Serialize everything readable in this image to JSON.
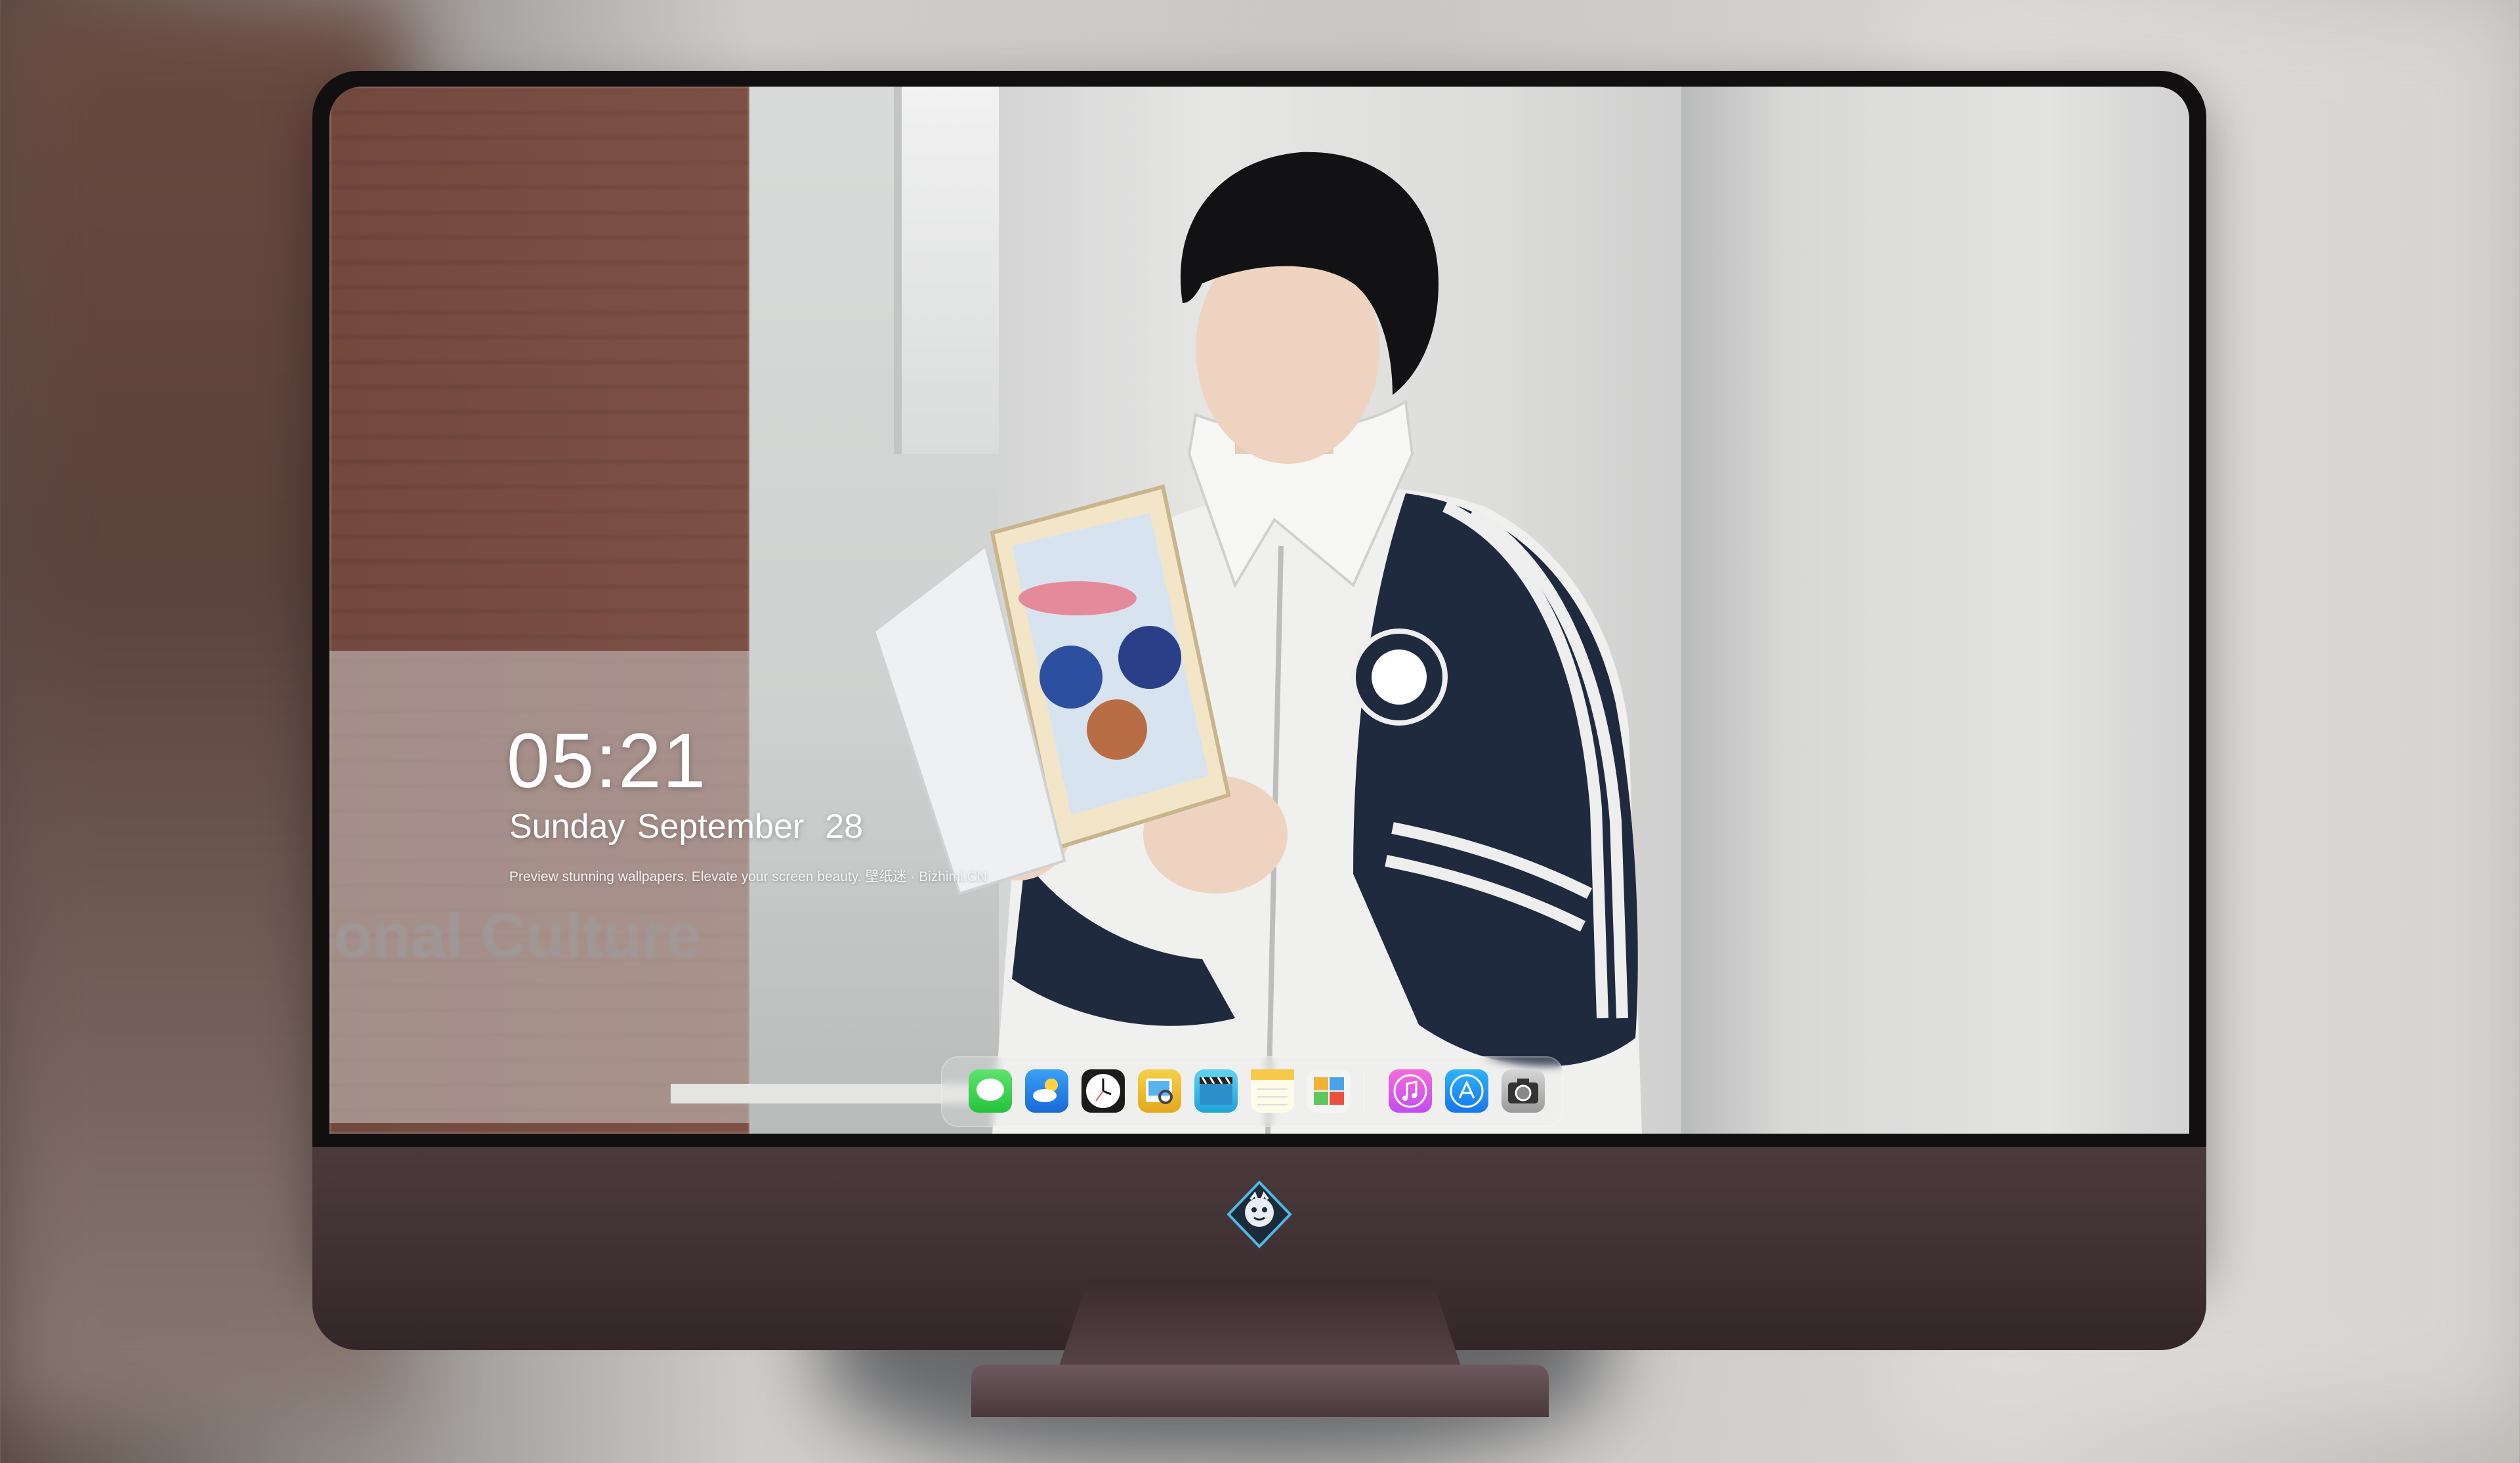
{
  "lockscreen": {
    "time": "05:21",
    "date_text": "Sunday September",
    "day_number": "28",
    "tagline": "Preview stunning wallpapers. Elevate your screen beauty. 壁纸迷 · Bizhimi.CN"
  },
  "scene": {
    "sign_text": "lonal Culture"
  },
  "dock": {
    "apps": [
      {
        "name": "messages-icon",
        "label": "Messages"
      },
      {
        "name": "weather-icon",
        "label": "Weather"
      },
      {
        "name": "clock-icon",
        "label": "Clock"
      },
      {
        "name": "preview-icon",
        "label": "Preview"
      },
      {
        "name": "video-editor-icon",
        "label": "Video Editor"
      },
      {
        "name": "notes-icon",
        "label": "Notes"
      },
      {
        "name": "photos-icon",
        "label": "Photos"
      },
      {
        "name": "music-icon",
        "label": "Music"
      },
      {
        "name": "app-store-icon",
        "label": "App Store"
      },
      {
        "name": "camera-icon",
        "label": "Camera"
      }
    ]
  },
  "colors": {
    "monitor_bezel": "#120f10",
    "monitor_chin": "#3e3032",
    "jacket_navy": "#1f2a3f",
    "jacket_white": "#f2f2f1"
  }
}
